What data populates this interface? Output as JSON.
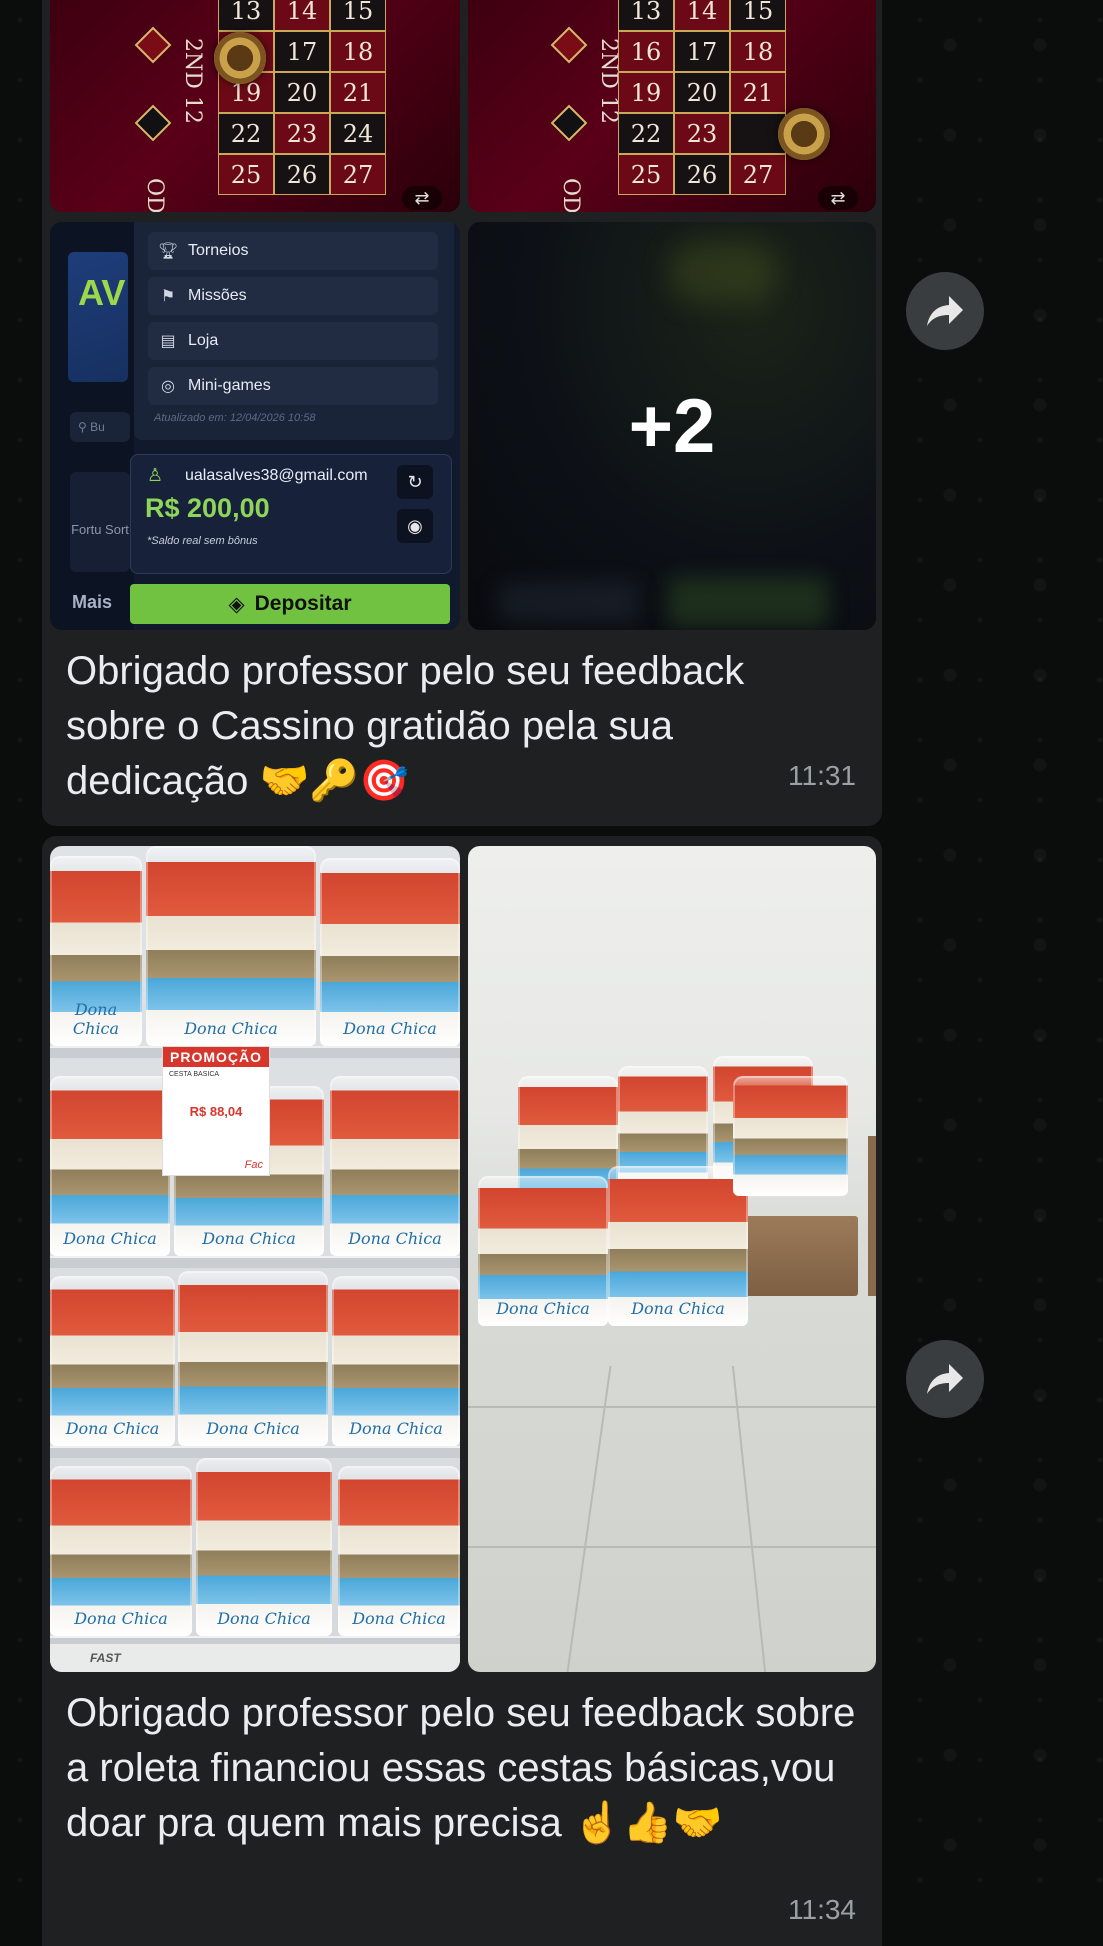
{
  "message1": {
    "roulette_left": {
      "grid": [
        [
          "13",
          "14",
          "15"
        ],
        [
          "",
          "17",
          "18"
        ],
        [
          "19",
          "20",
          "21"
        ],
        [
          "22",
          "23",
          "24"
        ],
        [
          "25",
          "26",
          "27"
        ]
      ],
      "side_label": "2ND 12",
      "bottom_label": "ODD"
    },
    "roulette_right": {
      "grid": [
        [
          "13",
          "14",
          "15"
        ],
        [
          "16",
          "17",
          "18"
        ],
        [
          "19",
          "20",
          "21"
        ],
        [
          "22",
          "23",
          ""
        ],
        [
          "25",
          "26",
          "27"
        ]
      ],
      "side_label": "2ND 12",
      "bottom_label": "ODD"
    },
    "casino_menu": {
      "items": [
        {
          "label": "Torneios",
          "icon": "trophy-icon"
        },
        {
          "label": "Missões",
          "icon": "medal-icon"
        },
        {
          "label": "Loja",
          "icon": "store-icon"
        },
        {
          "label": "Mini-games",
          "icon": "gamepad-icon"
        }
      ],
      "updated_text": "Atualizado em: 12/04/2026 10:58",
      "email": "ualasalves38@gmail.com",
      "balance": "R$ 200,00",
      "balance_note": "*Saldo real sem bônus",
      "deposit_label": "Depositar",
      "side_more": "Mais",
      "side_fortune": "Fortu Sort",
      "side_search": "Bu",
      "side_banner": "AV"
    },
    "more_label": "+2",
    "caption": "Obrigado professor pelo seu feedback sobre o Cassino gratidão pela sua dedicação 🤝🔑🎯",
    "time": "11:31"
  },
  "message2": {
    "promo": {
      "header": "PROMOÇÃO",
      "line": "CESTA BASICA",
      "price": "R$ 88,04",
      "tag": "Fac"
    },
    "bag_brand": "Dona Chica",
    "shelf_strip": "FAST",
    "caption": "Obrigado professor pelo seu feedback sobre a roleta financiou essas cestas básicas,vou doar pra quem mais precisa ☝️👍🤝",
    "time": "11:34"
  },
  "colors": {
    "bubble": "#1f2021",
    "text": "#e9edef",
    "time": "#9aa0a4",
    "deposit": "#72c241",
    "balance": "#8fd45b"
  }
}
